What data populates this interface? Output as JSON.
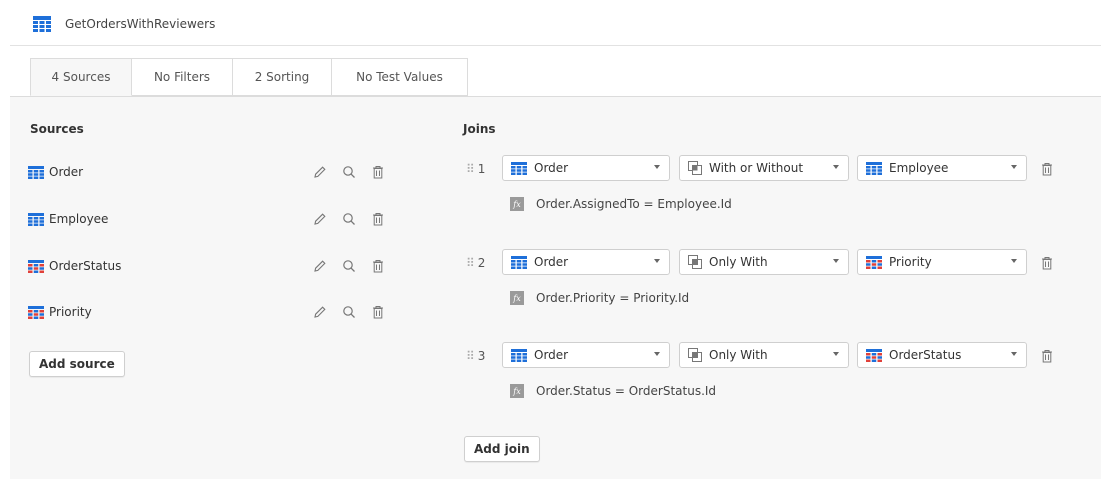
{
  "header": {
    "title": "GetOrdersWithReviewers"
  },
  "tabs": [
    {
      "label": "4 Sources",
      "active": true
    },
    {
      "label": "No Filters",
      "active": false
    },
    {
      "label": "2 Sorting",
      "active": false
    },
    {
      "label": "No Test Values",
      "active": false
    }
  ],
  "sources": {
    "heading": "Sources",
    "items": [
      {
        "name": "Order",
        "icon": "blue-grid-icon"
      },
      {
        "name": "Employee",
        "icon": "blue-grid-icon"
      },
      {
        "name": "OrderStatus",
        "icon": "multicolor-grid-icon"
      },
      {
        "name": "Priority",
        "icon": "multicolor-grid-icon"
      }
    ],
    "add_label": "Add source"
  },
  "joins": {
    "heading": "Joins",
    "items": [
      {
        "number": "1",
        "left": "Order",
        "type": "With or Without",
        "right": "Employee",
        "condition": "Order.AssignedTo = Employee.Id"
      },
      {
        "number": "2",
        "left": "Order",
        "type": "Only With",
        "right": "Priority",
        "condition": "Order.Priority = Priority.Id"
      },
      {
        "number": "3",
        "left": "Order",
        "type": "Only With",
        "right": "OrderStatus",
        "condition": "Order.Status = OrderStatus.Id"
      }
    ],
    "add_label": "Add join"
  },
  "colors": {
    "accent_blue": "#1e6fd9",
    "border": "#cfcfcf",
    "panel": "#f7f7f7",
    "icon_gray": "#8a8a8a"
  }
}
